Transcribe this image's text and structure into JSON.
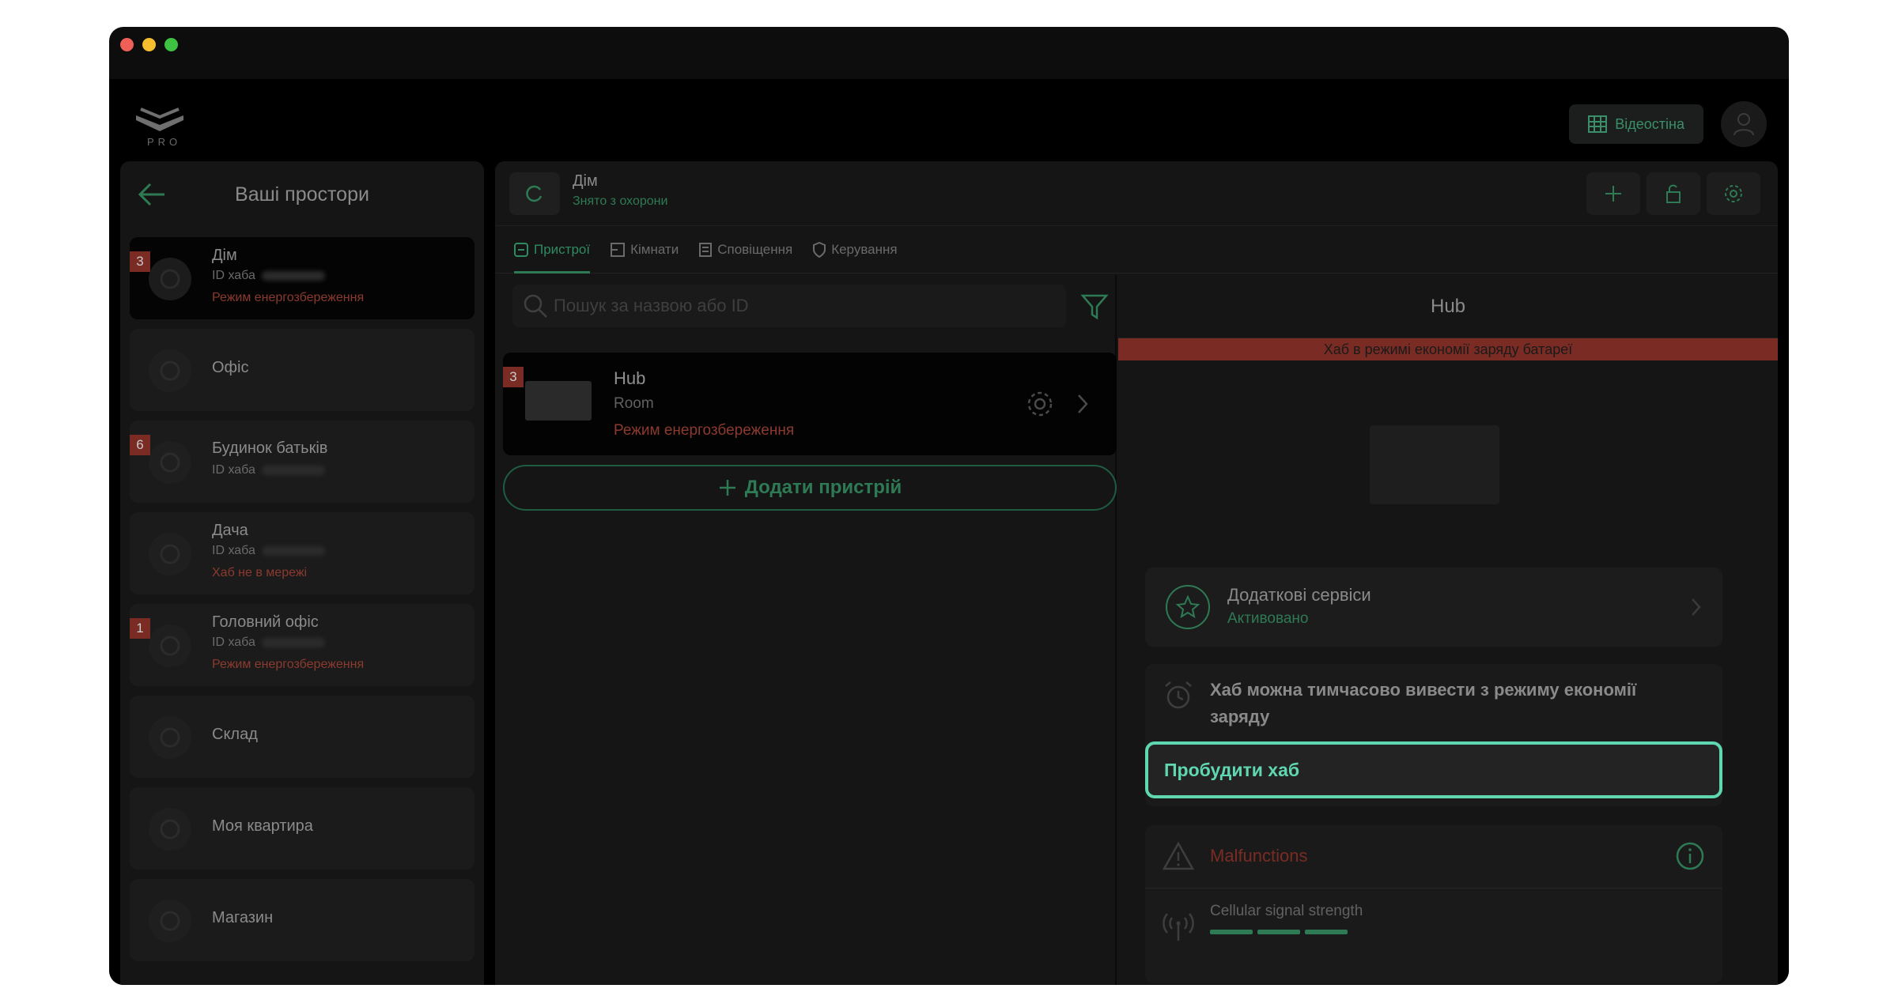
{
  "header": {
    "logo_text": "PRO",
    "videowall_label": "Відеостіна"
  },
  "left": {
    "title": "Ваші простори",
    "spaces": [
      {
        "name": "Дім",
        "hub_id_label": "ID хаба",
        "status": "Режим енергозбереження",
        "badge": "3"
      },
      {
        "name": "Офіс"
      },
      {
        "name": "Будинок батьків",
        "hub_id_label": "ID хаба",
        "badge": "6"
      },
      {
        "name": "Дача",
        "hub_id_label": "ID хаба",
        "status": "Хаб не в мережі"
      },
      {
        "name": "Головний офіс",
        "hub_id_label": "ID хаба",
        "status": "Режим енергозбереження",
        "badge": "1"
      },
      {
        "name": "Склад"
      },
      {
        "name": "Моя квартира"
      },
      {
        "name": "Магазин"
      }
    ]
  },
  "center": {
    "title": "Дім",
    "subtitle": "Знято з охорони",
    "tabs": [
      "Пристрої",
      "Кімнати",
      "Сповіщення",
      "Керування"
    ],
    "search_placeholder": "Пошук за назвою або ID",
    "device": {
      "badge": "3",
      "name": "Hub",
      "room": "Room",
      "status": "Режим енергозбереження"
    },
    "add_device_label": "Додати пристрій"
  },
  "detail": {
    "title": "Hub",
    "banner": "Хаб в режимі економії заряду батареї",
    "services_title": "Додаткові сервіси",
    "services_status": "Активовано",
    "wake_text": "Хаб можна тимчасово вивести з режиму економії заряду",
    "wake_button": "Пробудити хаб",
    "malfunctions_title": "Malfunctions",
    "signal_label": "Cellular signal strength",
    "signal_level": "3/3"
  },
  "colors": {
    "accent": "#2e7a55",
    "highlight": "#5fd7b0",
    "warning": "#8c3a2e"
  }
}
